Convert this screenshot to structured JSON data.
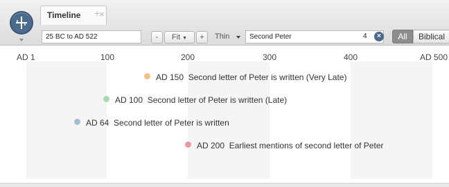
{
  "tab": {
    "title": "Timeline",
    "close": "×",
    "new": "+"
  },
  "toolbar": {
    "range_value": "25 BC to AD 522",
    "zoom_out": "-",
    "fit_label": "Fit",
    "zoom_in": "+",
    "thickness_label": "Thin",
    "search_value": "Second Peter",
    "result_count": "4",
    "clear_symbol": "×",
    "filter_all": "All",
    "filter_biblical": "Biblical"
  },
  "axis": {
    "ticks": [
      "AD 1",
      "100",
      "200",
      "300",
      "400",
      "AD 500"
    ]
  },
  "events": [
    {
      "date": "AD 150",
      "text": "Second letter of Peter is written (Very Late)",
      "color": "#f4c089"
    },
    {
      "date": "AD 100",
      "text": "Second letter of Peter is written (Late)",
      "color": "#a9d9ae"
    },
    {
      "date": "AD 64",
      "text": "Second letter of Peter is written",
      "color": "#a8bbd3"
    },
    {
      "date": "AD 200",
      "text": "Earliest mentions of second letter of Peter",
      "color": "#e59aa0"
    }
  ],
  "colors": {
    "accent": "#4e6a8b",
    "band": "#f5f5f5",
    "selected_filter": "#8d8d8d"
  }
}
